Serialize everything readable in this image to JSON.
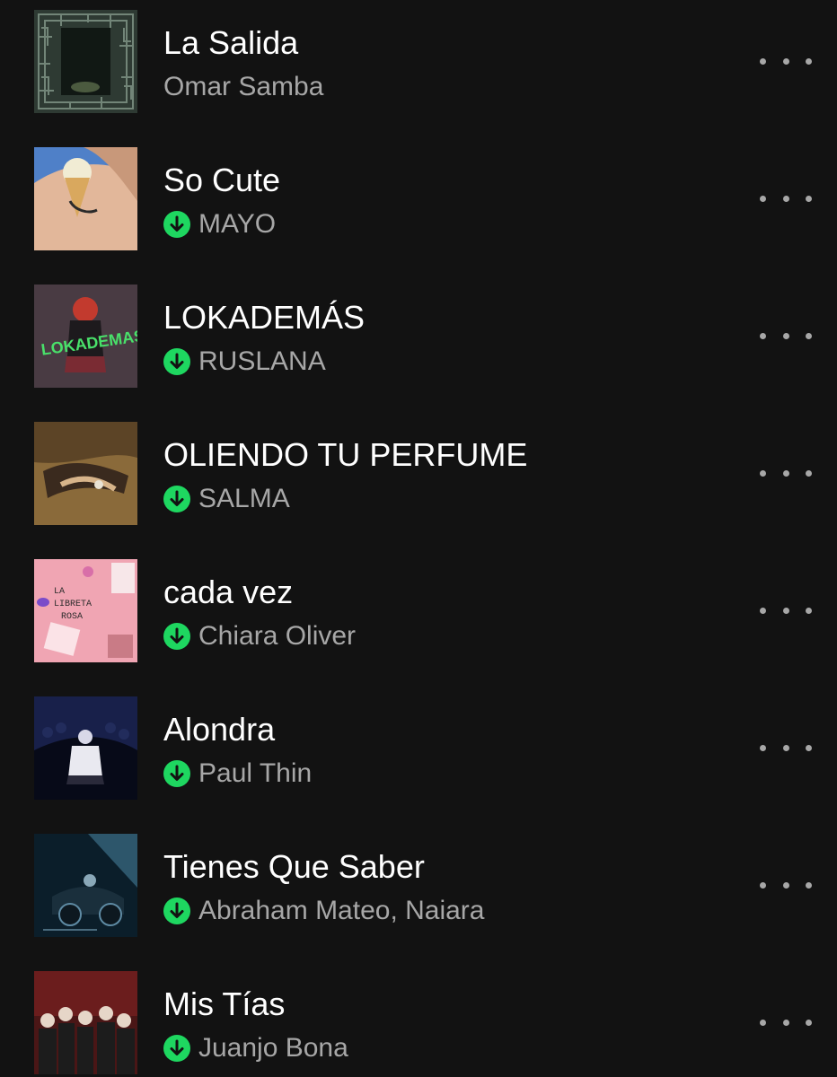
{
  "colors": {
    "background": "#121212",
    "title": "#ffffff",
    "subtitle": "#a7a7a7",
    "downloaded_accent": "#1ed760"
  },
  "icons": {
    "downloaded": "download-arrow-circle-icon",
    "more": "more-options-ellipsis-icon"
  },
  "tracks": [
    {
      "title": "La Salida",
      "artist": "Omar Samba",
      "downloaded": false
    },
    {
      "title": "So Cute",
      "artist": "MAYO",
      "downloaded": true
    },
    {
      "title": "LOKADEMÁS",
      "artist": "RUSLANA",
      "downloaded": true
    },
    {
      "title": "OLIENDO TU PERFUME",
      "artist": "SALMA",
      "downloaded": true
    },
    {
      "title": "cada vez",
      "artist": "Chiara Oliver",
      "downloaded": true
    },
    {
      "title": "Alondra",
      "artist": "Paul Thin",
      "downloaded": true
    },
    {
      "title": "Tienes Que Saber",
      "artist": "Abraham Mateo, Naiara",
      "downloaded": true
    },
    {
      "title": "Mis Tías",
      "artist": "Juanjo Bona",
      "downloaded": true
    }
  ]
}
